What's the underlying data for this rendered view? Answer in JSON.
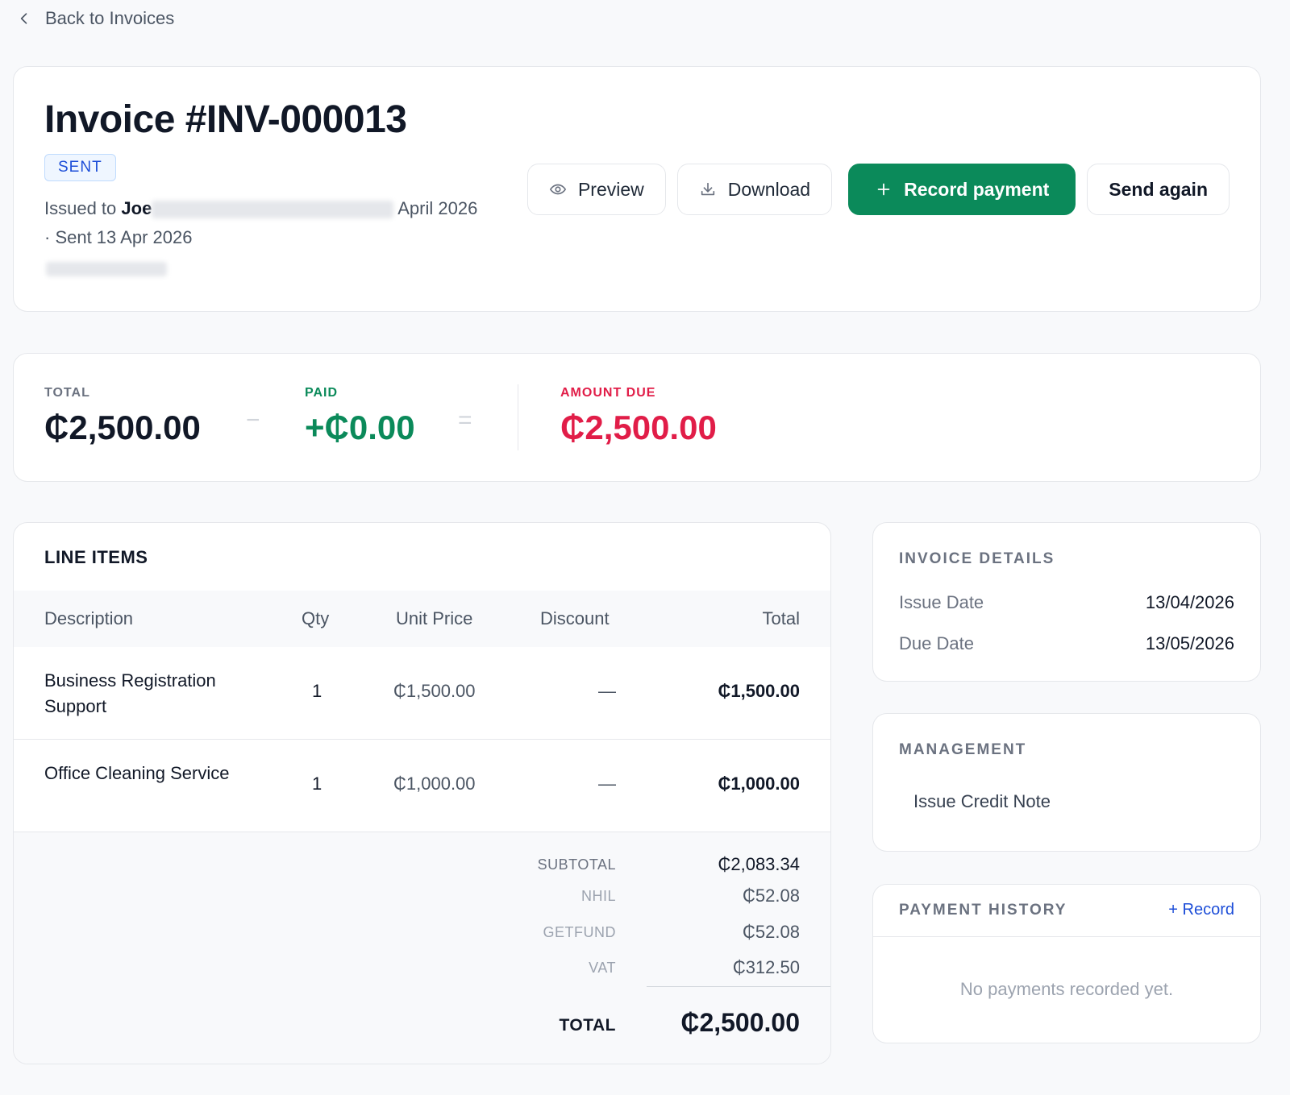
{
  "nav": {
    "back_label": "Back to Invoices"
  },
  "invoice": {
    "title": "Invoice #INV-000013",
    "status": "SENT",
    "issued_prefix": "Issued to",
    "customer_first": "Joe",
    "issued_suffix": "April 2026",
    "sent_line": "· Sent 13 Apr 2026"
  },
  "actions": {
    "preview": "Preview",
    "download": "Download",
    "record_payment": "Record payment",
    "send_again": "Send again"
  },
  "summary": {
    "total_label": "TOTAL",
    "total_value": "₵2,500.00",
    "minus": "−",
    "paid_label": "PAID",
    "paid_value": "+₵0.00",
    "equals": "=",
    "due_label": "AMOUNT DUE",
    "due_value": "₵2,500.00"
  },
  "line_items": {
    "title": "LINE ITEMS",
    "columns": [
      "Description",
      "Qty",
      "Unit Price",
      "Discount",
      "Total"
    ],
    "rows": [
      {
        "description": "Business Registration Support",
        "qty": "1",
        "unit_price": "₵1,500.00",
        "discount": "—",
        "total": "₵1,500.00"
      },
      {
        "description": "Office Cleaning Service",
        "qty": "1",
        "unit_price": "₵1,000.00",
        "discount": "—",
        "total": "₵1,000.00"
      }
    ],
    "totals": {
      "subtotal_label": "SUBTOTAL",
      "subtotal": "₵2,083.34",
      "nhil_label": "NHIL",
      "nhil": "₵52.08",
      "getfund_label": "GETFUND",
      "getfund": "₵52.08",
      "vat_label": "VAT",
      "vat": "₵312.50",
      "total_label": "TOTAL",
      "total": "₵2,500.00"
    }
  },
  "details": {
    "title": "INVOICE DETAILS",
    "issue_label": "Issue Date",
    "issue_value": "13/04/2026",
    "due_label": "Due Date",
    "due_value": "13/05/2026"
  },
  "management": {
    "title": "MANAGEMENT",
    "credit_note": "Issue Credit Note"
  },
  "history": {
    "title": "PAYMENT HISTORY",
    "record_link": "+ Record",
    "empty": "No payments recorded yet."
  },
  "colors": {
    "accent_green": "#0b8a5a",
    "due_red": "#e11d48",
    "badge_blue": "#1d4ed8"
  }
}
